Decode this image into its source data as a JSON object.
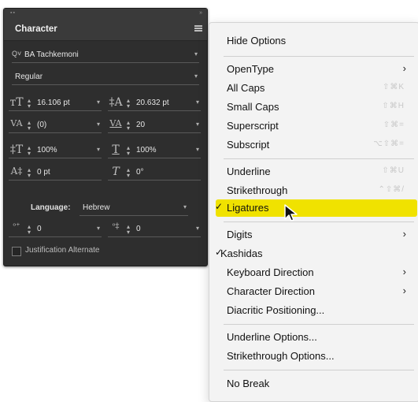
{
  "panel": {
    "title": "Character",
    "font_family": "BA Tachkemoni",
    "font_style": "Regular",
    "font_size": "16.106 pt",
    "leading": "20.632 pt",
    "kerning": "(0)",
    "tracking": "20",
    "vertical_scale": "100%",
    "horizontal_scale": "100%",
    "baseline_shift": "0 pt",
    "skew": "0°",
    "language_label": "Language:",
    "language_value": "Hebrew",
    "diacritic_x": "0",
    "diacritic_y": "0",
    "justification_label": "Justification Alternate"
  },
  "menu": {
    "items": [
      {
        "label": "Hide Options"
      },
      {
        "label": "OpenType",
        "submenu": true
      },
      {
        "label": "All Caps",
        "shortcut": "⇧⌘K"
      },
      {
        "label": "Small Caps",
        "shortcut": "⇧⌘H"
      },
      {
        "label": "Superscript",
        "shortcut": "⇧⌘="
      },
      {
        "label": "Subscript",
        "shortcut": "⌥⇧⌘="
      },
      {
        "label": "Underline",
        "shortcut": "⇧⌘U"
      },
      {
        "label": "Strikethrough",
        "shortcut": "⌃⇧⌘/"
      },
      {
        "label": "Ligatures",
        "checked": true,
        "highlighted": true
      },
      {
        "label": "Digits",
        "submenu": true
      },
      {
        "label": "Kashidas",
        "checked": true
      },
      {
        "label": "Keyboard Direction",
        "submenu": true
      },
      {
        "label": "Character Direction",
        "submenu": true
      },
      {
        "label": "Diacritic Positioning..."
      },
      {
        "label": "Underline Options..."
      },
      {
        "label": "Strikethrough Options..."
      },
      {
        "label": "No Break"
      }
    ],
    "check_glyph": "✓",
    "arrow_glyph": "›"
  },
  "colors": {
    "panel_bg": "#2e2e2e",
    "menu_bg": "#f3f3f3",
    "highlight": "#f0e200"
  },
  "icons": [
    "find-font-icon",
    "font-size-icon",
    "leading-icon",
    "kerning-icon",
    "tracking-icon",
    "vertical-scale-icon",
    "horizontal-scale-icon",
    "baseline-shift-icon",
    "skew-icon",
    "panel-menu-icon",
    "mouse-pointer-icon"
  ]
}
